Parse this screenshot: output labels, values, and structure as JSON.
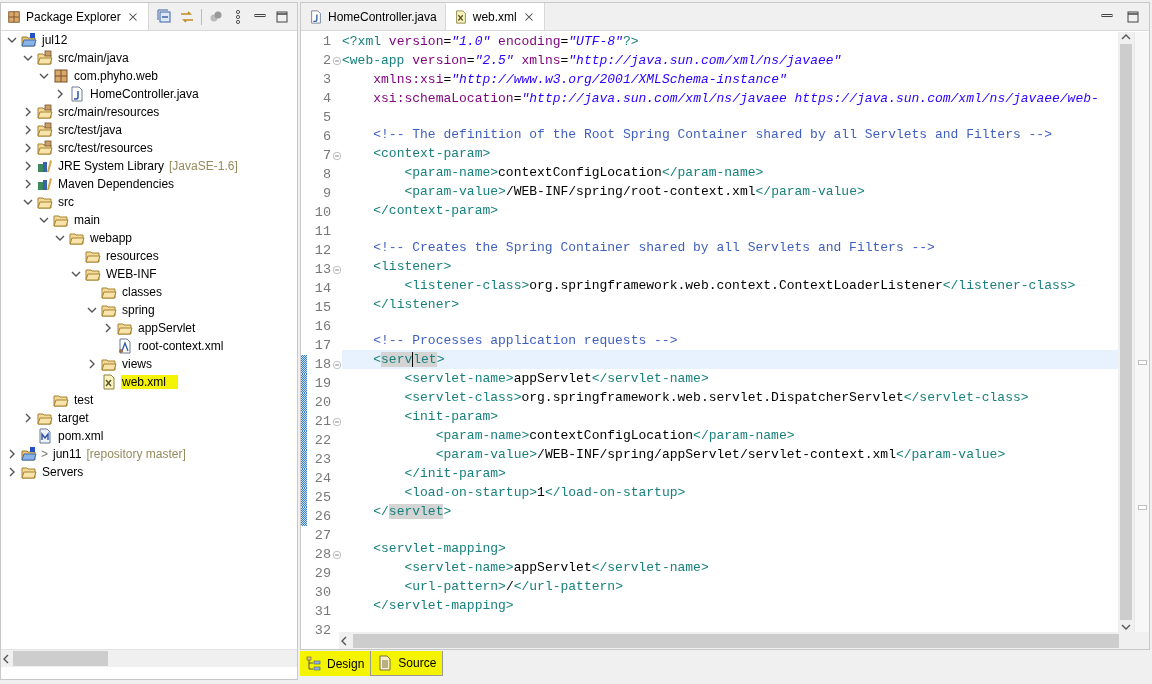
{
  "package_explorer": {
    "title": "Package Explorer",
    "tree": [
      {
        "label": "jul12",
        "kind": "project",
        "expanded": true,
        "selected": false,
        "children": [
          {
            "label": "src/main/java",
            "kind": "source-folder",
            "expanded": true,
            "selected": false,
            "children": [
              {
                "label": "com.phyho.web",
                "kind": "package",
                "expanded": true,
                "selected": false,
                "children": [
                  {
                    "label": "HomeController.java",
                    "kind": "java-file",
                    "expanded": false,
                    "selected": false
                  }
                ]
              }
            ]
          },
          {
            "label": "src/main/resources",
            "kind": "source-folder",
            "expanded": false,
            "selected": false
          },
          {
            "label": "src/test/java",
            "kind": "source-folder",
            "expanded": false,
            "selected": false
          },
          {
            "label": "src/test/resources",
            "kind": "source-folder",
            "expanded": false,
            "selected": false
          },
          {
            "label": "JRE System Library",
            "decoration": "[JavaSE-1.6]",
            "kind": "library",
            "expanded": false,
            "selected": false
          },
          {
            "label": "Maven Dependencies",
            "kind": "library",
            "expanded": false,
            "selected": false
          },
          {
            "label": "src",
            "kind": "folder",
            "expanded": true,
            "selected": false,
            "children": [
              {
                "label": "main",
                "kind": "folder",
                "expanded": true,
                "selected": false,
                "children": [
                  {
                    "label": "webapp",
                    "kind": "folder",
                    "expanded": true,
                    "selected": false,
                    "children": [
                      {
                        "label": "resources",
                        "kind": "folder",
                        "selected": false
                      },
                      {
                        "label": "WEB-INF",
                        "kind": "folder",
                        "expanded": true,
                        "selected": false,
                        "children": [
                          {
                            "label": "classes",
                            "kind": "folder",
                            "selected": false
                          },
                          {
                            "label": "spring",
                            "kind": "folder",
                            "expanded": true,
                            "selected": false,
                            "children": [
                              {
                                "label": "appServlet",
                                "kind": "folder",
                                "expanded": false,
                                "selected": false
                              },
                              {
                                "label": "root-context.xml",
                                "kind": "spring-file",
                                "selected": false
                              }
                            ]
                          },
                          {
                            "label": "views",
                            "kind": "folder",
                            "expanded": false,
                            "selected": false
                          },
                          {
                            "label": "web.xml",
                            "kind": "xml-file",
                            "selected": true,
                            "highlighted": true
                          }
                        ]
                      }
                    ]
                  }
                ]
              },
              {
                "label": "test",
                "kind": "folder",
                "selected": false
              }
            ]
          },
          {
            "label": "target",
            "kind": "folder",
            "expanded": false,
            "selected": false
          },
          {
            "label": "pom.xml",
            "kind": "pom-file",
            "selected": false
          }
        ]
      },
      {
        "label": "jun11",
        "prefix": ">",
        "decoration": "[repository master]",
        "kind": "project",
        "expanded": false,
        "selected": false
      },
      {
        "label": "Servers",
        "kind": "folder",
        "expanded": false,
        "selected": false
      }
    ]
  },
  "editor": {
    "tabs": [
      {
        "label": "HomeController.java",
        "kind": "java-file",
        "selected": false
      },
      {
        "label": "web.xml",
        "kind": "xml-file",
        "selected": true
      }
    ],
    "lines": [
      {
        "number": "1",
        "text": "<?xml version=\"1.0\" encoding=\"UTF-8\"?>",
        "foldable": false,
        "current": false,
        "changed": false,
        "occurrence": false
      },
      {
        "number": "2",
        "text": "<web-app version=\"2.5\" xmlns=\"http://java.sun.com/xml/ns/javaee\"",
        "foldable": true,
        "current": false,
        "changed": false,
        "occurrence": false
      },
      {
        "number": "3",
        "text": "    xmlns:xsi=\"http://www.w3.org/2001/XMLSchema-instance\"",
        "foldable": false,
        "current": false,
        "changed": false,
        "occurrence": false
      },
      {
        "number": "4",
        "text": "    xsi:schemaLocation=\"http://java.sun.com/xml/ns/javaee https://java.sun.com/xml/ns/javaee/web-",
        "foldable": false,
        "current": false,
        "changed": false,
        "occurrence": false
      },
      {
        "number": "5",
        "foldable": false,
        "current": false,
        "changed": false,
        "occurrence": false
      },
      {
        "number": "6",
        "text": "    <!-- The definition of the Root Spring Container shared by all Servlets and Filters -->",
        "foldable": false,
        "current": false,
        "changed": false,
        "occurrence": false
      },
      {
        "number": "7",
        "text": "    <context-param>",
        "foldable": true,
        "current": false,
        "changed": false,
        "occurrence": false
      },
      {
        "number": "8",
        "text": "        <param-name>contextConfigLocation</param-name>",
        "foldable": false,
        "current": false,
        "changed": false,
        "occurrence": false
      },
      {
        "number": "9",
        "text": "        <param-value>/WEB-INF/spring/root-context.xml</param-value>",
        "foldable": false,
        "current": false,
        "changed": false,
        "occurrence": false
      },
      {
        "number": "10",
        "text": "    </context-param>",
        "foldable": false,
        "current": false,
        "changed": false,
        "occurrence": false
      },
      {
        "number": "11",
        "foldable": false,
        "current": false,
        "changed": false,
        "occurrence": false
      },
      {
        "number": "12",
        "text": "    <!-- Creates the Spring Container shared by all Servlets and Filters -->",
        "foldable": false,
        "current": false,
        "changed": false,
        "occurrence": false
      },
      {
        "number": "13",
        "text": "    <listener>",
        "foldable": true,
        "current": false,
        "changed": false,
        "occurrence": false
      },
      {
        "number": "14",
        "text": "        <listener-class>org.springframework.web.context.ContextLoaderListener</listener-class>",
        "foldable": false,
        "current": false,
        "changed": false,
        "occurrence": false
      },
      {
        "number": "15",
        "text": "    </listener>",
        "foldable": false,
        "current": false,
        "changed": false,
        "occurrence": false
      },
      {
        "number": "16",
        "foldable": false,
        "current": false,
        "changed": false,
        "occurrence": false
      },
      {
        "number": "17",
        "text": "    <!-- Processes application requests -->",
        "foldable": false,
        "current": false,
        "changed": false,
        "occurrence": false
      },
      {
        "number": "18",
        "text": "    <servlet>",
        "foldable": true,
        "current": true,
        "changed": true,
        "occurrence": true
      },
      {
        "number": "19",
        "text": "        <servlet-name>appServlet</servlet-name>",
        "foldable": false,
        "current": false,
        "changed": true,
        "occurrence": false
      },
      {
        "number": "20",
        "text": "        <servlet-class>org.springframework.web.servlet.DispatcherServlet</servlet-class>",
        "foldable": false,
        "current": false,
        "changed": true,
        "occurrence": false
      },
      {
        "number": "21",
        "text": "        <init-param>",
        "foldable": true,
        "current": false,
        "changed": true,
        "occurrence": false
      },
      {
        "number": "22",
        "text": "            <param-name>contextConfigLocation</param-name>",
        "foldable": false,
        "current": false,
        "changed": true,
        "occurrence": false
      },
      {
        "number": "23",
        "text": "            <param-value>/WEB-INF/spring/appServlet/servlet-context.xml</param-value>",
        "foldable": false,
        "current": false,
        "changed": true,
        "occurrence": false
      },
      {
        "number": "24",
        "text": "        </init-param>",
        "foldable": false,
        "current": false,
        "changed": true,
        "occurrence": false
      },
      {
        "number": "25",
        "text": "        <load-on-startup>1</load-on-startup>",
        "foldable": false,
        "current": false,
        "changed": true,
        "occurrence": false
      },
      {
        "number": "26",
        "text": "    </servlet>",
        "foldable": false,
        "current": false,
        "changed": true,
        "occurrence": true
      },
      {
        "number": "27",
        "foldable": false,
        "current": false,
        "changed": false,
        "occurrence": false
      },
      {
        "number": "28",
        "text": "    <servlet-mapping>",
        "foldable": true,
        "current": false,
        "changed": false,
        "occurrence": false
      },
      {
        "number": "29",
        "text": "        <servlet-name>appServlet</servlet-name>",
        "foldable": false,
        "current": false,
        "changed": false,
        "occurrence": false
      },
      {
        "number": "30",
        "text": "        <url-pattern>/</url-pattern>",
        "foldable": false,
        "current": false,
        "changed": false,
        "occurrence": false
      },
      {
        "number": "31",
        "text": "    </servlet-mapping>",
        "foldable": false,
        "current": false,
        "changed": false,
        "occurrence": false
      },
      {
        "number": "32",
        "foldable": false,
        "current": false,
        "changed": false,
        "occurrence": false
      }
    ],
    "page_tabs": {
      "highlighted": true,
      "items": [
        {
          "label": "Design",
          "kind": "tree",
          "selected": false
        },
        {
          "label": "Source",
          "kind": "page",
          "selected": true
        }
      ]
    }
  }
}
